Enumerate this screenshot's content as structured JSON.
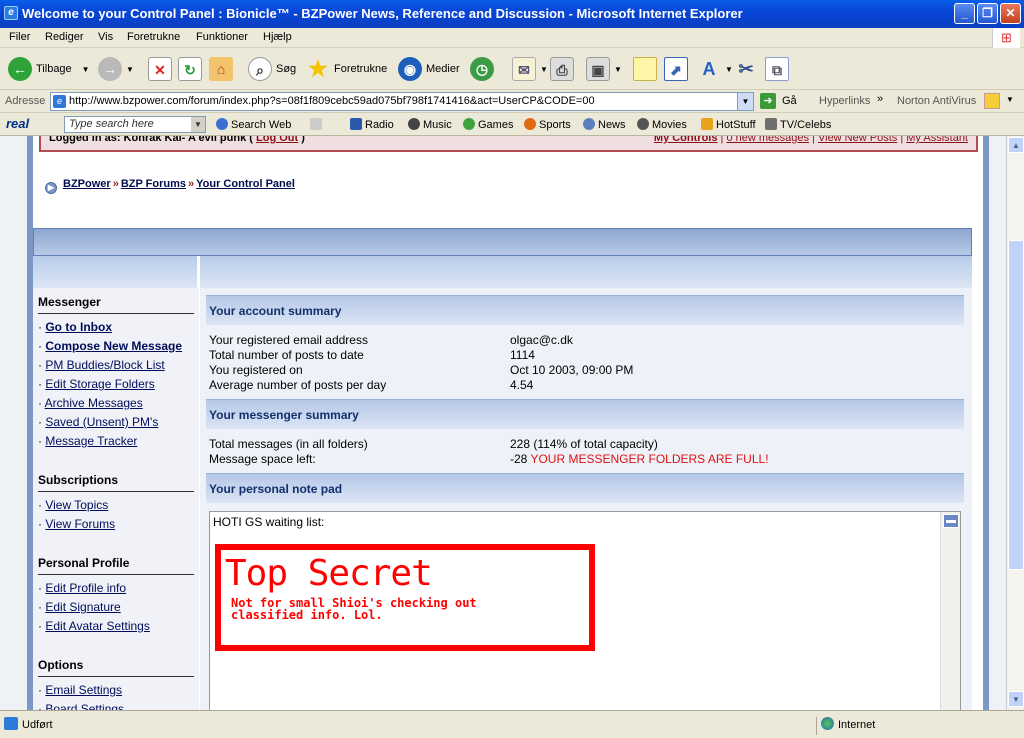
{
  "window": {
    "title": "Welcome to your Control Panel : Bionicle™ - BZPower News, Reference and Discussion - Microsoft Internet Explorer"
  },
  "menu": [
    "Filer",
    "Rediger",
    "Vis",
    "Foretrukne",
    "Funktioner",
    "Hjælp"
  ],
  "toolbar": {
    "back": "Tilbage",
    "search": "Søg",
    "favorites": "Foretrukne",
    "media": "Medier"
  },
  "address": {
    "label": "Adresse",
    "url": "http://www.bzpower.com/forum/index.php?s=08f1f809cebc59ad075bf798f1741416&act=UserCP&CODE=00",
    "go": "Gå",
    "links": "Hyperlinks",
    "norton": "Norton AntiVirus"
  },
  "realbar": {
    "logo": "real",
    "search_placeholder": "Type search here",
    "search_web": "Search Web",
    "radio": "Radio",
    "music": "Music",
    "games": "Games",
    "sports": "Sports",
    "news": "News",
    "movies": "Movies",
    "hotstuff": "HotStuff",
    "tvcelebs": "TV/Celebs"
  },
  "userbar": {
    "logged": "Logged in as: Konrak Kai- A evil punk",
    "logout": "Log Out",
    "my_controls": "My Controls",
    "new_messages": "0 new messages",
    "view_new": "View New Posts",
    "assistant": "My Assistant"
  },
  "breadcrumb": [
    "BZPower",
    "BZP Forums",
    "Your Control Panel"
  ],
  "sidebar": {
    "messenger": "Messenger",
    "messenger_links": [
      "Go to Inbox",
      "Compose New Message",
      "PM Buddies/Block List",
      "Edit Storage Folders",
      "Archive Messages",
      "Saved (Unsent) PM's",
      "Message Tracker"
    ],
    "subscriptions": "Subscriptions",
    "subscription_links": [
      "View Topics",
      "View Forums"
    ],
    "profile": "Personal Profile",
    "profile_links": [
      "Edit Profile info",
      "Edit Signature",
      "Edit Avatar Settings"
    ],
    "options": "Options",
    "option_links": [
      "Email Settings",
      "Board Settings"
    ]
  },
  "account": {
    "title": "Your account summary",
    "rows": [
      {
        "k": "Your registered email address",
        "v": "olgac@c.dk"
      },
      {
        "k": "Total number of posts to date",
        "v": "1114"
      },
      {
        "k": "You registered on",
        "v": "Oct 10 2003, 09:00 PM"
      },
      {
        "k": "Average number of posts per day",
        "v": "4.54"
      }
    ]
  },
  "messenger": {
    "title": "Your messenger summary",
    "total_k": "Total messages (in all folders)",
    "total_v": "228 (114% of total capacity)",
    "space_k": "Message space left:",
    "space_v": "-28",
    "space_warn": "YOUR MESSENGER FOLDERS ARE FULL!"
  },
  "notepad": {
    "title": "Your personal note pad",
    "text": "HOTI GS waiting list:",
    "secret_big": "Top Secret",
    "secret_line1": "Not for small Shioi's checking out",
    "secret_line2": "classified info. Lol."
  },
  "status": {
    "left": "Udført",
    "zone": "Internet"
  }
}
